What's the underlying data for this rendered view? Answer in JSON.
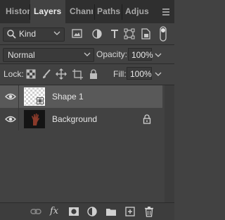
{
  "tabs": [
    {
      "label": "Histor",
      "active": false
    },
    {
      "label": "Layers",
      "active": true
    },
    {
      "label": "Chann",
      "active": false
    },
    {
      "label": "Paths",
      "active": false
    },
    {
      "label": "Adjus",
      "active": false
    }
  ],
  "filter": {
    "kind_label": "Kind",
    "icons": [
      "pixel-filter-icon",
      "adjustment-filter-icon",
      "type-filter-icon",
      "shape-filter-icon",
      "smart-object-filter-icon",
      "filter-toggle-icon"
    ]
  },
  "blend": {
    "mode": "Normal",
    "opacity_label": "Opacity:",
    "opacity_value": "100%"
  },
  "lock": {
    "label": "Lock:",
    "fill_label": "Fill:",
    "fill_value": "100%",
    "icons": [
      "lock-transparent-icon",
      "lock-pixels-icon",
      "lock-position-icon",
      "lock-artboard-icon",
      "lock-all-icon"
    ]
  },
  "layers": [
    {
      "name": "Shape 1",
      "visible": true,
      "selected": true,
      "locked": false
    },
    {
      "name": "Background",
      "visible": true,
      "selected": false,
      "locked": true
    }
  ],
  "bottom_icons": [
    "link-icon",
    "fx-icon",
    "mask-icon",
    "adjustment-layer-icon",
    "folder-icon",
    "new-layer-icon",
    "trash-icon"
  ],
  "bottom_labels": {
    "fx": "fx"
  },
  "colors": {
    "panel": "#424242",
    "tabbar": "#2f2f2f",
    "selected_row": "#595959"
  }
}
